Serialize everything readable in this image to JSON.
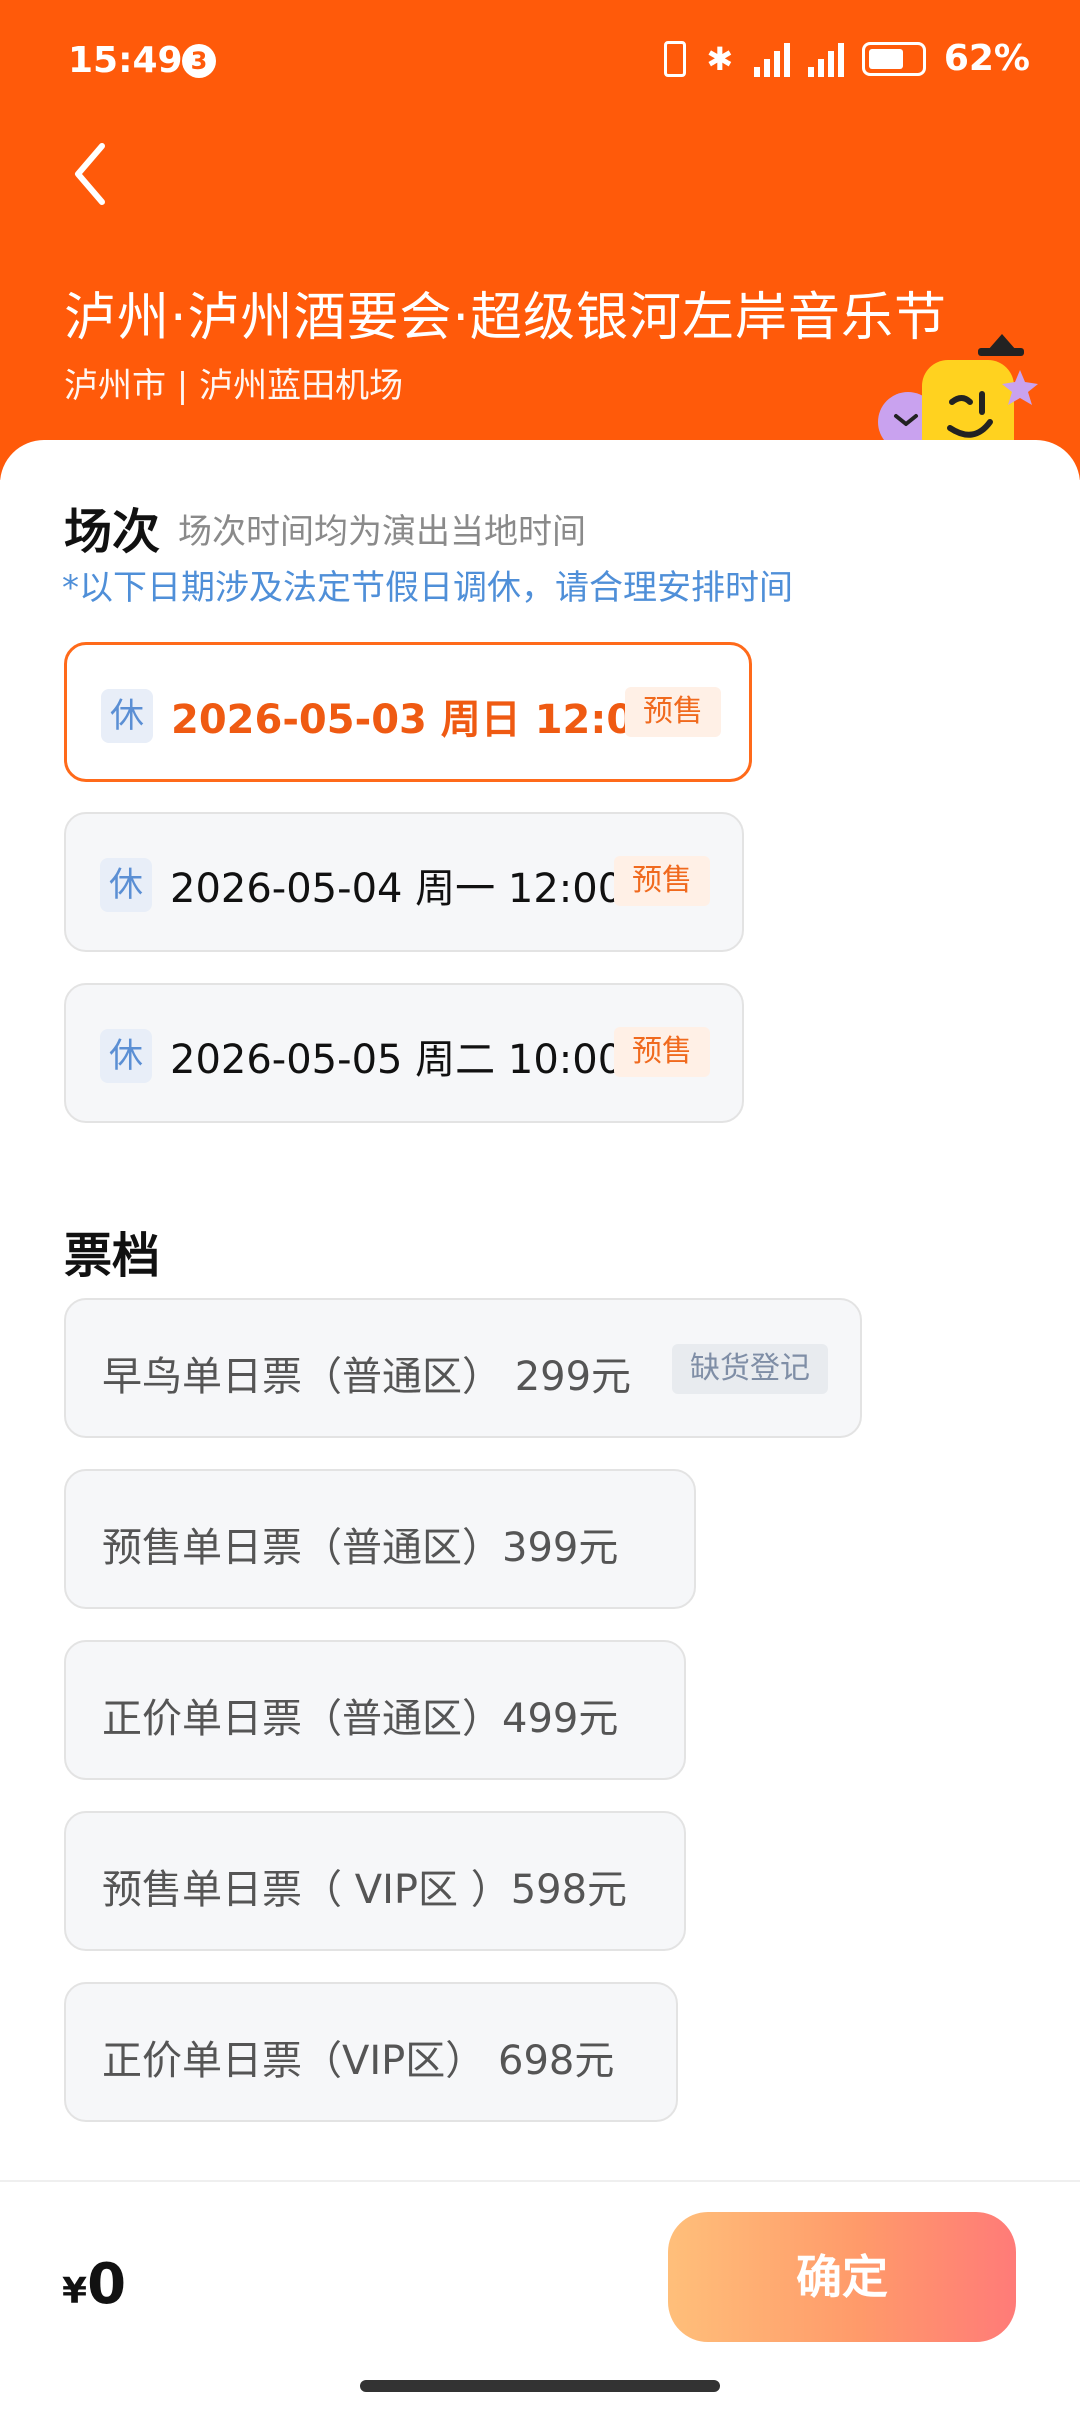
{
  "status_bar": {
    "time": "15:49",
    "notification_count": "3",
    "battery": "62%"
  },
  "header": {
    "title": "泸州·泸州酒要会·超级银河左岸音乐节",
    "subtitle": "泸州市 | 泸州蓝田机场"
  },
  "sessions_section": {
    "title": "场次",
    "subtitle": "场次时间均为演出当地时间",
    "holiday_note": "*以下日期涉及法定节假日调休，请合理安排时间",
    "items": [
      {
        "rest_tag": "休",
        "datetime": "2026-05-03  周日 12:00",
        "badge": "预售",
        "selected": true
      },
      {
        "rest_tag": "休",
        "datetime": "2026-05-04 周一 12:00",
        "badge": "预售",
        "selected": false
      },
      {
        "rest_tag": "休",
        "datetime": "2026-05-05 周二 10:00",
        "badge": "预售",
        "selected": false
      }
    ]
  },
  "tickets_section": {
    "title": "票档",
    "items": [
      {
        "label": "早鸟单日票（普通区） 299元",
        "badge": "缺货登记"
      },
      {
        "label": "预售单日票（普通区）399元"
      },
      {
        "label": "正价单日票（普通区）499元"
      },
      {
        "label": "预售单日票（ VIP区 ）598元"
      },
      {
        "label": "正价单日票（VIP区） 698元"
      }
    ]
  },
  "footer": {
    "currency": "¥",
    "amount": "0",
    "confirm_label": "确定"
  },
  "colors": {
    "header_bg": "#ff5a0a",
    "accent": "#ef5a12",
    "note_blue": "#4f8fd8"
  }
}
